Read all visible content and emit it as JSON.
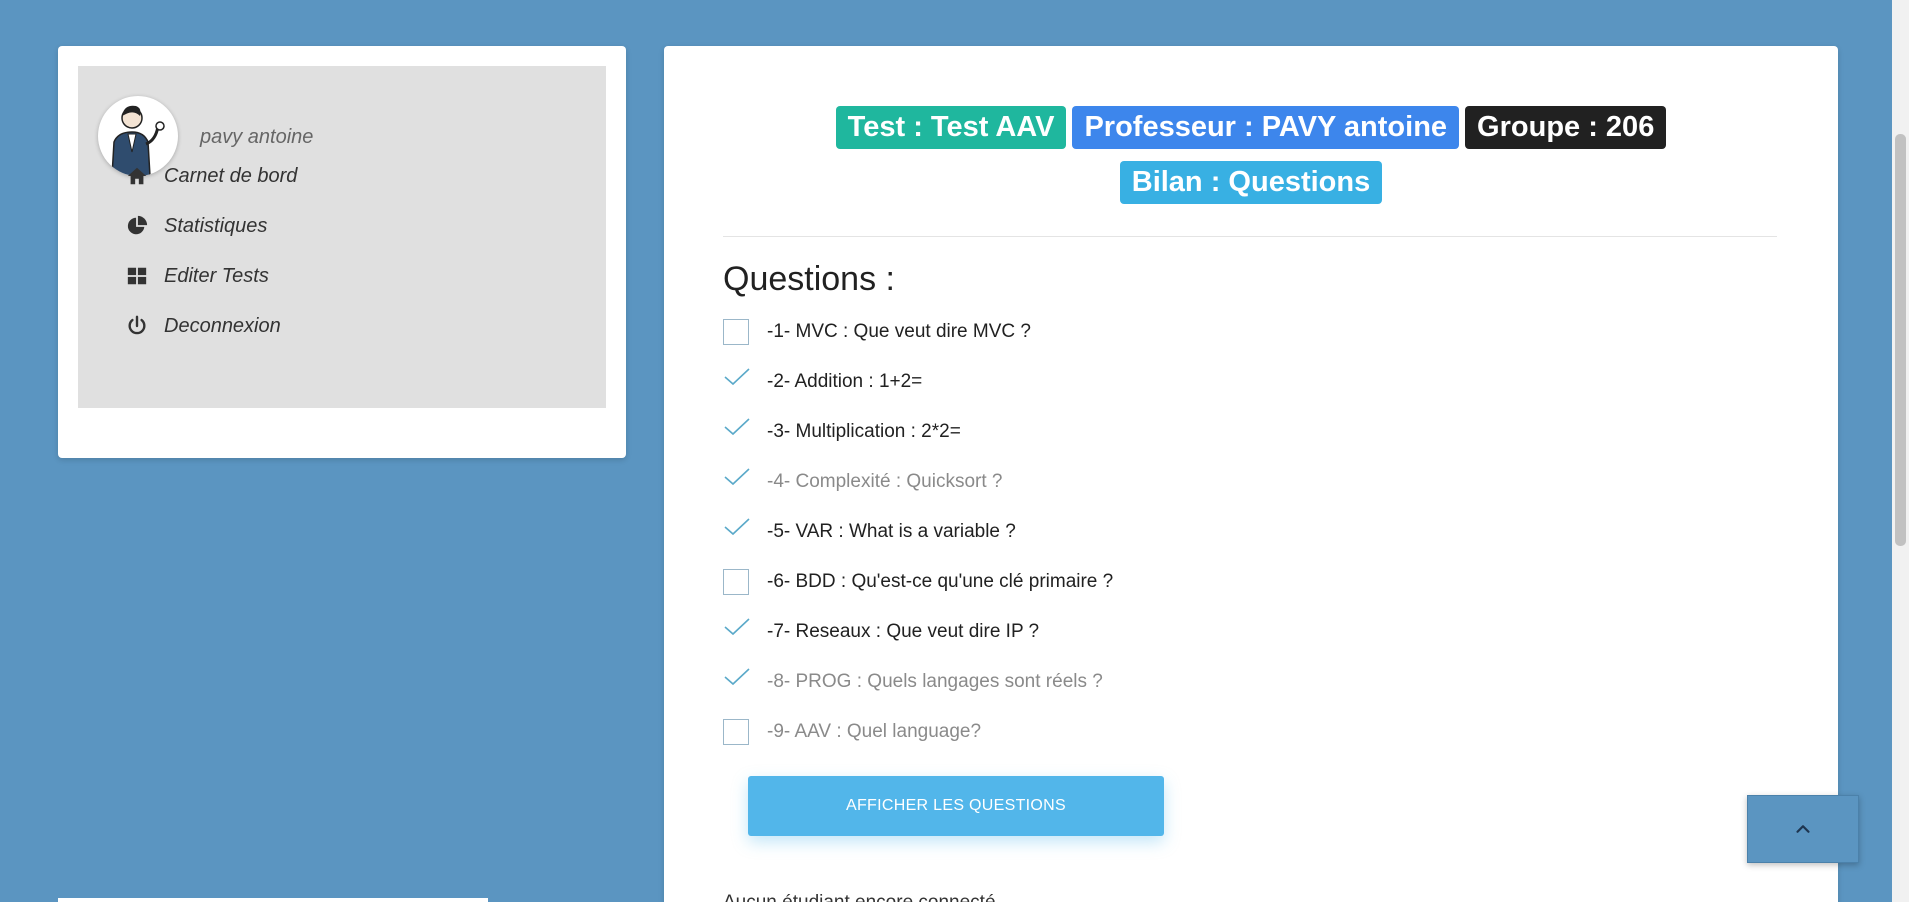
{
  "user": {
    "name": "pavy antoine"
  },
  "nav": [
    {
      "label": "Carnet de bord",
      "icon": "home-icon"
    },
    {
      "label": "Statistiques",
      "icon": "pie-chart-icon"
    },
    {
      "label": "Editer Tests",
      "icon": "grid-icon"
    },
    {
      "label": "Deconnexion",
      "icon": "power-icon"
    }
  ],
  "badges": {
    "test": "Test : Test AAV",
    "professor": "Professeur : PAVY antoine",
    "group": "Groupe : 206",
    "report": "Bilan : Questions"
  },
  "colors": {
    "background": "#5b95c1",
    "badge_test": "#1fb79e",
    "badge_professor": "#3d86ec",
    "badge_group": "#212121",
    "badge_report": "#38b0e3",
    "button": "#52b6ea",
    "check": "#5aa9c9"
  },
  "questions_title": "Questions :",
  "questions": [
    {
      "text": "-1- MVC : Que veut dire MVC ?",
      "state": "unchecked",
      "muted": false
    },
    {
      "text": "-2- Addition : 1+2=",
      "state": "checked",
      "muted": false
    },
    {
      "text": "-3- Multiplication : 2*2=",
      "state": "checked",
      "muted": false
    },
    {
      "text": "-4- Complexité : Quicksort ?",
      "state": "checked",
      "muted": true
    },
    {
      "text": "-5- VAR : What is a variable ?",
      "state": "checked",
      "muted": false
    },
    {
      "text": "-6- BDD : Qu'est-ce qu'une clé primaire ?",
      "state": "unchecked",
      "muted": false
    },
    {
      "text": "-7- Reseaux : Que veut dire IP ?",
      "state": "checked",
      "muted": false
    },
    {
      "text": "-8- PROG : Quels langages sont réels ?",
      "state": "checked",
      "muted": true
    },
    {
      "text": "-9- AAV : Quel language?",
      "state": "unchecked",
      "muted": true
    }
  ],
  "show_button_label": "AFFICHER LES QUESTIONS",
  "status_text": "Aucun étudiant encore connecté"
}
